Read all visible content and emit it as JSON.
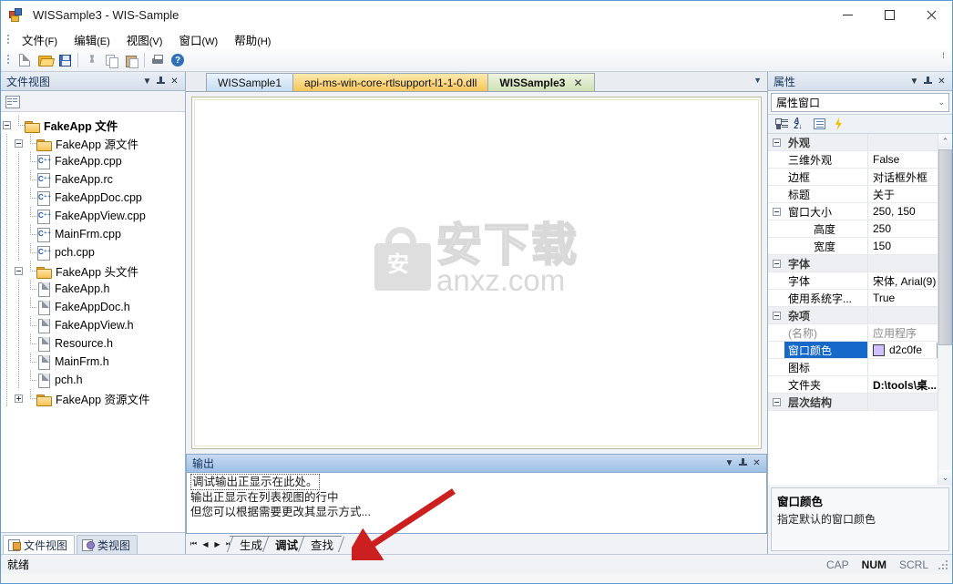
{
  "window": {
    "title": "WISSample3 - WIS-Sample",
    "app_icon": "app-icon",
    "minimize": "—",
    "maximize": "□",
    "close": "✕"
  },
  "menubar": [
    {
      "label": "文件",
      "mnemonic": "(F)"
    },
    {
      "label": "编辑",
      "mnemonic": "(E)"
    },
    {
      "label": "视图",
      "mnemonic": "(V)"
    },
    {
      "label": "窗口",
      "mnemonic": "(W)"
    },
    {
      "label": "帮助",
      "mnemonic": "(H)"
    }
  ],
  "toolbar": {
    "buttons": [
      "new-file-icon",
      "open-folder-icon",
      "save-icon",
      "cut-icon",
      "copy-icon",
      "paste-icon",
      "print-icon",
      "help-icon"
    ],
    "overflow": "⁞"
  },
  "left_panel": {
    "title": "文件视图",
    "dropdown": "▼",
    "pin": "pin-icon",
    "close": "✕",
    "toolbar_icon": "properties-icon",
    "tree": [
      {
        "label": "FakeApp 文件",
        "depth": 0,
        "icon": "folder",
        "expander": "minus",
        "bold": true
      },
      {
        "label": "FakeApp 源文件",
        "depth": 1,
        "icon": "folder",
        "expander": "minus"
      },
      {
        "label": "FakeApp.cpp",
        "depth": 2,
        "icon": "cpp"
      },
      {
        "label": "FakeApp.rc",
        "depth": 2,
        "icon": "cpp"
      },
      {
        "label": "FakeAppDoc.cpp",
        "depth": 2,
        "icon": "cpp"
      },
      {
        "label": "FakeAppView.cpp",
        "depth": 2,
        "icon": "cpp"
      },
      {
        "label": "MainFrm.cpp",
        "depth": 2,
        "icon": "cpp"
      },
      {
        "label": "pch.cpp",
        "depth": 2,
        "icon": "cpp"
      },
      {
        "label": "FakeApp 头文件",
        "depth": 1,
        "icon": "folder",
        "expander": "minus"
      },
      {
        "label": "FakeApp.h",
        "depth": 2,
        "icon": "doc"
      },
      {
        "label": "FakeAppDoc.h",
        "depth": 2,
        "icon": "doc"
      },
      {
        "label": "FakeAppView.h",
        "depth": 2,
        "icon": "doc"
      },
      {
        "label": "Resource.h",
        "depth": 2,
        "icon": "doc"
      },
      {
        "label": "MainFrm.h",
        "depth": 2,
        "icon": "doc"
      },
      {
        "label": "pch.h",
        "depth": 2,
        "icon": "doc"
      },
      {
        "label": "FakeApp 资源文件",
        "depth": 1,
        "icon": "folder",
        "expander": "plus"
      }
    ],
    "bottom_tabs": [
      {
        "label": "文件视图",
        "icon": "file-view-icon",
        "active": true
      },
      {
        "label": "类视图",
        "icon": "class-view-icon",
        "active": false
      }
    ]
  },
  "editor": {
    "tabs": [
      {
        "label": "WISSample1",
        "style": "blue",
        "active": false,
        "closable": false
      },
      {
        "label": "api-ms-win-core-rtlsupport-l1-1-0.dll",
        "style": "yellow",
        "active": false,
        "closable": false
      },
      {
        "label": "WISSample3",
        "style": "green",
        "active": true,
        "closable": true,
        "close": "✕"
      }
    ],
    "tab_overflow": "▼",
    "watermark": {
      "cn": "安下载",
      "en": "anxz.com",
      "bag_char": "安"
    }
  },
  "output_panel": {
    "title": "输出",
    "dropdown": "▼",
    "pin": "pin-icon",
    "close": "✕",
    "lines": [
      "调试输出正显示在此处。",
      "输出正显示在列表视图的行中",
      "但您可以根据需要更改其显示方式..."
    ],
    "nav": [
      "⏮",
      "◀",
      "▶",
      "⏭"
    ],
    "tabs": [
      {
        "label": "生成",
        "active": false
      },
      {
        "label": "调试",
        "active": true
      },
      {
        "label": "查找",
        "active": false
      }
    ]
  },
  "properties_panel": {
    "title": "属性",
    "dropdown": "▼",
    "pin": "pin-icon",
    "close": "✕",
    "combo_value": "属性窗口",
    "combo_caret": "⌄",
    "toolbar": [
      "categorized-icon",
      "alphabetical-sort-icon",
      "property-pages-icon",
      "events-icon"
    ],
    "rows": [
      {
        "type": "category",
        "name": "外观",
        "value": "",
        "expander": "minus"
      },
      {
        "type": "prop",
        "name": "三维外观",
        "value": "False"
      },
      {
        "type": "prop",
        "name": "边框",
        "value": "对话框外框"
      },
      {
        "type": "prop",
        "name": "标题",
        "value": "关于"
      },
      {
        "type": "parent",
        "name": "窗口大小",
        "value": "250, 150",
        "expander": "minus"
      },
      {
        "type": "child",
        "name": "高度",
        "value": "250"
      },
      {
        "type": "child",
        "name": "宽度",
        "value": "150"
      },
      {
        "type": "category",
        "name": "字体",
        "value": "",
        "expander": "minus"
      },
      {
        "type": "prop",
        "name": "字体",
        "value": "宋体, Arial(9)"
      },
      {
        "type": "prop",
        "name": "使用系统字...",
        "value": "True"
      },
      {
        "type": "category",
        "name": "杂项",
        "value": "",
        "expander": "minus"
      },
      {
        "type": "prop",
        "name": "(名称)",
        "value": "应用程序",
        "dim": true
      },
      {
        "type": "prop",
        "name": "窗口颜色",
        "value": "d2c0fe",
        "selected": true,
        "swatch": "#d2c0fe",
        "dropdown": "▾"
      },
      {
        "type": "prop",
        "name": "图标",
        "value": ""
      },
      {
        "type": "prop",
        "name": "文件夹",
        "value": "D:\\tools\\桌...",
        "bold": true
      },
      {
        "type": "category",
        "name": "层次结构",
        "value": "",
        "expander": "minus"
      }
    ],
    "scrollbar": {
      "up": "⌃",
      "down": "⌄"
    },
    "description": {
      "title": "窗口颜色",
      "text": "指定默认的窗口颜色"
    }
  },
  "statusbar": {
    "message": "就绪",
    "indicators": [
      {
        "label": "CAP",
        "active": false
      },
      {
        "label": "NUM",
        "active": true
      },
      {
        "label": "SCRL",
        "active": false
      }
    ]
  }
}
